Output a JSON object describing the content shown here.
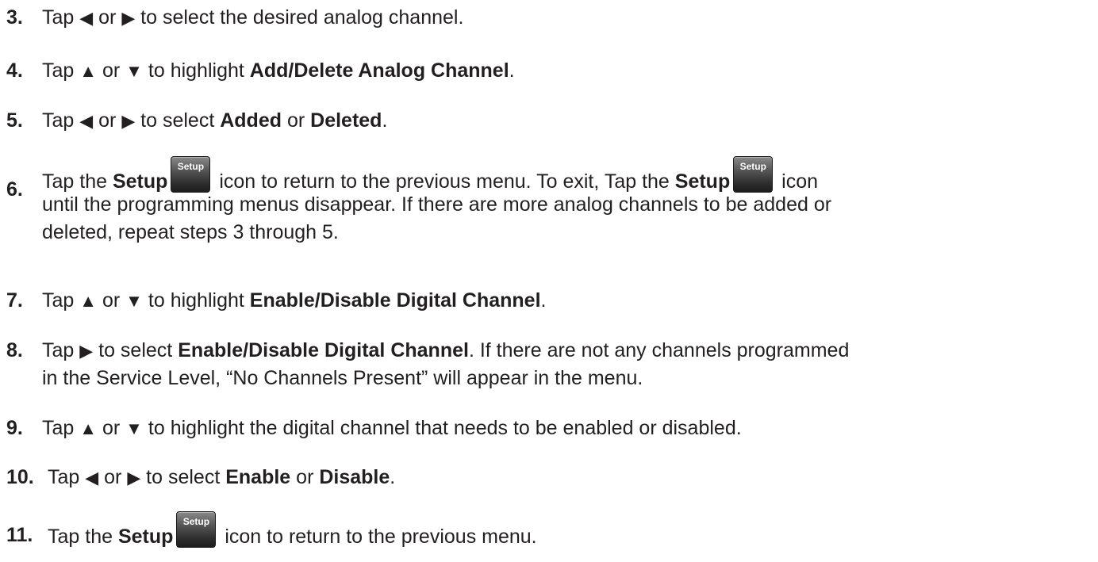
{
  "steps": [
    {
      "num": "3.",
      "parts": {
        "a": "Tap ",
        "left": "◀",
        "b": " or ",
        "right": "▶",
        "c": " to select the desired analog channel."
      }
    },
    {
      "num": "4.",
      "parts": {
        "a": "Tap ",
        "up": "▲",
        "b": " or ",
        "down": "▼",
        "c": " to highlight ",
        "bold": "Add/Delete Analog Channel",
        "d": "."
      }
    },
    {
      "num": "5.",
      "parts": {
        "a": "Tap ",
        "left": "◀",
        "b": " or ",
        "right": "▶",
        "c": " to select ",
        "bold1": "Added",
        "d": " or ",
        "bold2": "Deleted",
        "e": "."
      }
    },
    {
      "num": "6.",
      "parts": {
        "a": "Tap the ",
        "bold1": "Setup",
        "b": " icon to return to the previous menu. To exit, Tap the ",
        "bold2": "Setup",
        "c": " icon",
        "line2": "until the programming menus disappear. If there are more analog channels to be added or",
        "line3": "deleted, repeat steps 3 through 5."
      }
    },
    {
      "num": "7.",
      "parts": {
        "a": "Tap ",
        "up": "▲",
        "b": " or ",
        "down": "▼",
        "c": " to highlight ",
        "bold": "Enable/Disable Digital Channel",
        "d": "."
      }
    },
    {
      "num": "8.",
      "parts": {
        "a": "Tap ",
        "right": "▶",
        "b": " to select ",
        "bold": "Enable/Disable Digital Channel",
        "c": ". If there are not any channels programmed",
        "line2": "in the Service Level, “No Channels Present” will appear in the menu."
      }
    },
    {
      "num": "9.",
      "parts": {
        "a": "Tap ",
        "up": "▲",
        "b": " or ",
        "down": "▼",
        "c": " to highlight the digital channel that needs to be enabled or disabled."
      }
    },
    {
      "num": "10.",
      "parts": {
        "a": "Tap ",
        "left": "◀",
        "b": " or ",
        "right": "▶",
        "c": " to select ",
        "bold1": "Enable",
        "d": " or ",
        "bold2": "Disable",
        "e": "."
      }
    },
    {
      "num": "11.",
      "parts": {
        "a": "Tap the ",
        "bold": "Setup",
        "b": " icon to return to the previous menu."
      }
    }
  ],
  "icons": {
    "setup_label": "Setup",
    "left_arrow": "left-triangle-icon",
    "right_arrow": "right-triangle-icon",
    "up_arrow": "up-triangle-icon",
    "down_arrow": "down-triangle-icon",
    "setup_icon": "setup-button-icon"
  }
}
